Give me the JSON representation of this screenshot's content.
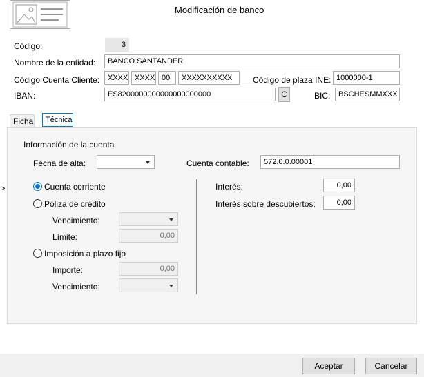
{
  "window": {
    "title": "Modificación de banco"
  },
  "fields": {
    "codigo": {
      "label": "Código:",
      "value": "3"
    },
    "nombre": {
      "label": "Nombre de la entidad:",
      "value": "BANCO SANTANDER"
    },
    "ccc": {
      "label": "Código Cuenta Cliente:",
      "part1": "XXXX",
      "part2": "XXXX",
      "part3": "00",
      "part4": "XXXXXXXXXX"
    },
    "plaza": {
      "label": "Código de plaza INE:",
      "value": "1000000-1"
    },
    "iban": {
      "label": "IBAN:",
      "value": "ES8200000000000000000000",
      "button": "C"
    },
    "bic": {
      "label": "BIC:",
      "value": "BSCHESMMXXX"
    }
  },
  "tabs": [
    {
      "label": "Ficha",
      "active": false
    },
    {
      "label": "Técnica",
      "active": true
    }
  ],
  "panel": {
    "group_title": "Información de la cuenta",
    "fecha_alta": {
      "label": "Fecha de alta:",
      "value": ""
    },
    "cuenta_contable": {
      "label": "Cuenta contable:",
      "value": "572.0.0.00001"
    },
    "radios": {
      "corriente": {
        "label": "Cuenta corriente",
        "checked": true
      },
      "poliza": {
        "label": "Póliza de crédito",
        "checked": false
      },
      "imposicion": {
        "label": "Imposición a plazo fijo",
        "checked": false
      }
    },
    "poliza": {
      "vencimiento_label": "Vencimiento:",
      "limite_label": "Límite:",
      "limite_value": "0,00"
    },
    "imposicion": {
      "importe_label": "Importe:",
      "importe_value": "0,00",
      "vencimiento_label": "Vencimiento:"
    },
    "interes": {
      "label": "Interés:",
      "value": "0,00"
    },
    "interes_descubiertos": {
      "label": "Interés sobre descubiertos:",
      "value": "0,00"
    }
  },
  "footer": {
    "accept": "Aceptar",
    "cancel": "Cancelar"
  },
  "side_marker": ">"
}
